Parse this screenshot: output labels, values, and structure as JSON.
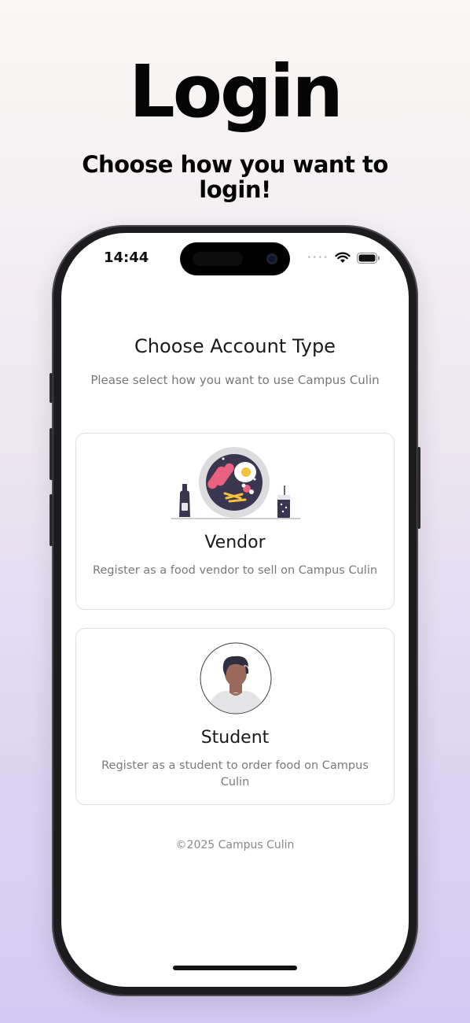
{
  "promo": {
    "headline": "Login",
    "subheadline": "Choose how you want to login!"
  },
  "status_bar": {
    "time": "14:44",
    "signal_dots": "••••",
    "icons": [
      "wifi-icon",
      "battery-icon"
    ]
  },
  "screen": {
    "title": "Choose Account Type",
    "subtitle": "Please select how you want to use Campus Culin",
    "options": [
      {
        "name": "Vendor",
        "description": "Register as a food vendor to sell on Campus Culin",
        "illustration": "food-plate-illustration"
      },
      {
        "name": "Student",
        "description": "Register as a student to order food on Campus Culin",
        "illustration": "student-avatar-illustration"
      }
    ],
    "footer": "©2025 Campus Culin"
  },
  "colors": {
    "background_top": "#faf7f4",
    "background_bottom": "#d4caf3",
    "phone_frame": "#1c1c1e",
    "card_border": "#e0e0e4",
    "text_primary": "#1a1a1a",
    "text_secondary": "#7a7a7a",
    "plate_dark": "#3b3650",
    "accent_pink": "#e9617f",
    "accent_yellow": "#f5c23a",
    "skin_tone": "#9c6a5d"
  }
}
